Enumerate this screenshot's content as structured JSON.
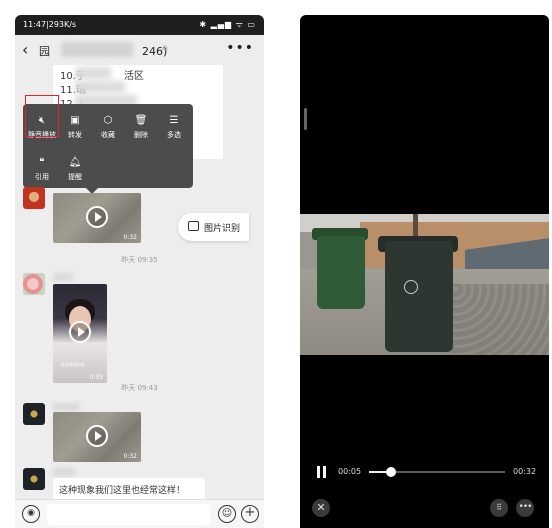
{
  "status_bar": {
    "time": "11:47|293K/s",
    "right_icons": "✱ ▂▄▆ ᯤ ▭"
  },
  "chat": {
    "title_prefix": "园",
    "title_suffix": "246)",
    "back_icon": "chevron-left-icon",
    "more_icon": "ellipsis-icon"
  },
  "text_message": {
    "lines": [
      "10.于",
      "11.瑞",
      "12.上"
    ],
    "line_1_suffix": "活区"
  },
  "context_menu": {
    "items": [
      {
        "label": "静音播放",
        "icon": "speaker-mute-icon",
        "glyph": "🔇︎"
      },
      {
        "label": "转发",
        "icon": "forward-icon",
        "glyph": "▣"
      },
      {
        "label": "收藏",
        "icon": "favorite-cube-icon",
        "glyph": "⬡"
      },
      {
        "label": "删除",
        "icon": "trash-icon",
        "glyph": "🗑︎"
      },
      {
        "label": "多选",
        "icon": "multi-select-icon",
        "glyph": "☰"
      },
      {
        "label": "引用",
        "icon": "quote-icon",
        "glyph": "❝"
      },
      {
        "label": "提醒",
        "icon": "bell-icon",
        "glyph": "🔔︎"
      }
    ]
  },
  "messages": {
    "video_1_duration": "0:32",
    "timestamp_1": "昨天 09:35",
    "portrait_duration": "0:33",
    "portrait_caption": "吃花家酒你在",
    "timestamp_2": "昨天 09:43",
    "video_2_duration": "0:32",
    "partial_text": "这种现象我们这里也经常这样！"
  },
  "ocr_pill": {
    "label": "图片识别",
    "icon": "image-icon"
  },
  "input_bar": {
    "voice_icon": "voice-icon",
    "emoji_icon": "emoji-icon",
    "plus_icon": "plus-icon"
  },
  "player": {
    "current_time": "00:05",
    "total_time": "00:32",
    "progress": 0.16,
    "close_icon": "close-icon",
    "grid_icon": "grid-icon",
    "more_icon": "more-icon"
  }
}
